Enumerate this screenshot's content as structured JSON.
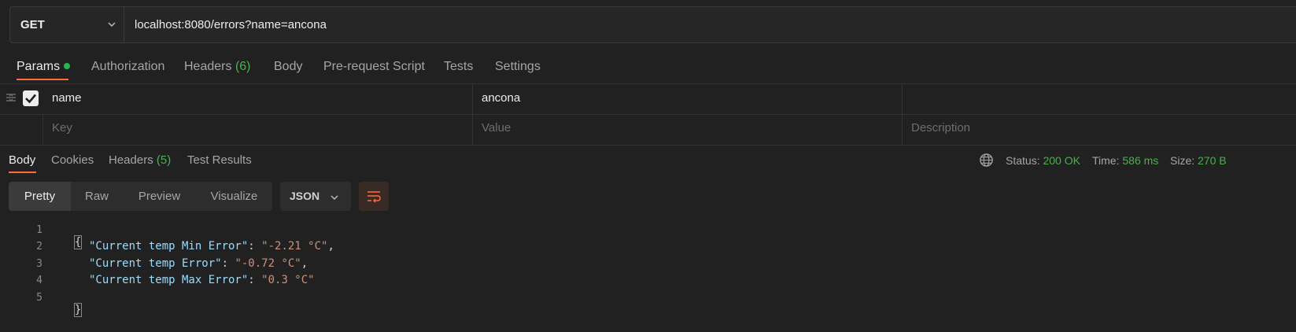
{
  "request": {
    "method": "GET",
    "url": "localhost:8080/errors?name=ancona"
  },
  "request_tabs": {
    "params": "Params",
    "authorization": "Authorization",
    "headers": "Headers",
    "headers_count": "(6)",
    "body": "Body",
    "prerequest": "Pre-request Script",
    "tests": "Tests",
    "settings": "Settings"
  },
  "params": {
    "row": {
      "key": "name",
      "value": "ancona",
      "checked": true
    },
    "placeholders": {
      "key": "Key",
      "value": "Value",
      "description": "Description"
    }
  },
  "response_tabs": {
    "body": "Body",
    "cookies": "Cookies",
    "headers": "Headers",
    "headers_count": "(5)",
    "test_results": "Test Results"
  },
  "response_meta": {
    "status_label": "Status:",
    "status_value": "200 OK",
    "time_label": "Time:",
    "time_value": "586 ms",
    "size_label": "Size:",
    "size_value": "270 B"
  },
  "view_modes": {
    "pretty": "Pretty",
    "raw": "Raw",
    "preview": "Preview",
    "visualize": "Visualize"
  },
  "format": "JSON",
  "code": {
    "line_numbers": [
      "1",
      "2",
      "3",
      "4",
      "5"
    ],
    "open_brace": "{",
    "close_brace": "}",
    "lines": [
      {
        "key": "\"Current temp Min Error\"",
        "value": "\"-2.21 °C\"",
        "tail": ","
      },
      {
        "key": "\"Current temp Error\"",
        "value": "\"-0.72 °C\"",
        "tail": ","
      },
      {
        "key": "\"Current temp Max Error\"",
        "value": "\"0.3 °C\"",
        "tail": ""
      }
    ],
    "colon": ": "
  },
  "colors": {
    "accent": "#ff6c37",
    "success": "#4caf50",
    "json_key": "#9cdcfe",
    "json_string": "#ce9178"
  },
  "icons": [
    "chevron-down-icon",
    "checkbox-checked-icon",
    "drag-handle-icon",
    "globe-icon",
    "wrap-lines-icon"
  ]
}
